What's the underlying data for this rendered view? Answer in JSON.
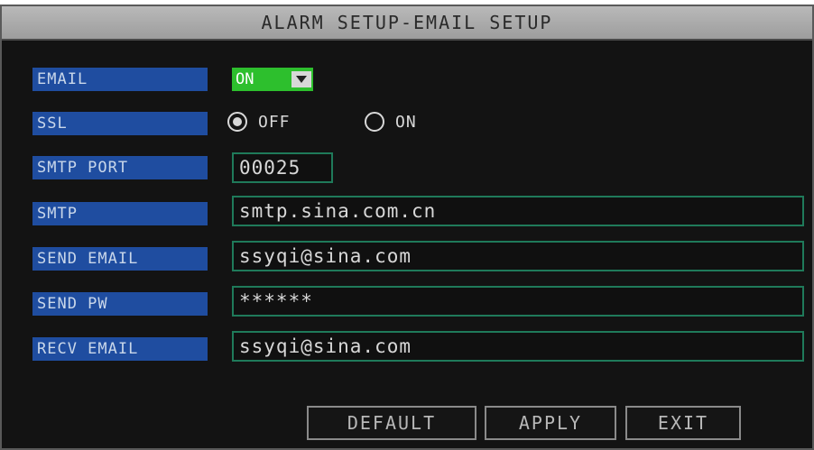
{
  "title": "ALARM SETUP-EMAIL SETUP",
  "labels": {
    "email": "EMAIL",
    "ssl": "SSL",
    "smtp_port": "SMTP PORT",
    "smtp": "SMTP",
    "send_email": "SEND EMAIL",
    "send_pw": "SEND PW",
    "recv_email": "RECV EMAIL"
  },
  "email": {
    "value": "ON",
    "arrow_icon": "chevron-down-icon"
  },
  "ssl": {
    "options": [
      "OFF",
      "ON"
    ],
    "selected": "OFF"
  },
  "fields": {
    "smtp_port": "00025",
    "smtp": "smtp.sina.com.cn",
    "send_email": "ssyqi@sina.com",
    "send_pw": "******",
    "recv_email": "ssyqi@sina.com"
  },
  "buttons": {
    "default": "DEFAULT",
    "apply": "APPLY",
    "exit": "EXIT"
  },
  "colors": {
    "label_bg": "#1f4da0",
    "dropdown_bg": "#2dbf2d",
    "field_border": "#1f7a5a",
    "background": "#131313"
  }
}
